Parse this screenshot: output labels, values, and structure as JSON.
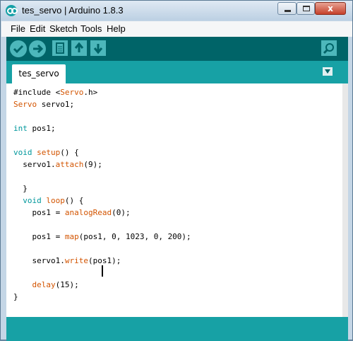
{
  "window": {
    "title": "tes_servo | Arduino 1.8.3",
    "controls": {
      "minimize": "minimize",
      "maximize": "maximize",
      "close": "x"
    }
  },
  "menu": [
    "File",
    "Edit",
    "Sketch",
    "Tools",
    "Help"
  ],
  "toolbar": {
    "verify_icon": "checkmark-icon",
    "upload_icon": "arrow-right-icon",
    "new_icon": "document-icon",
    "open_icon": "arrow-up-icon",
    "save_icon": "arrow-down-icon",
    "serial_monitor_icon": "magnifier-icon"
  },
  "tabs": [
    {
      "label": "tes_servo"
    }
  ],
  "editor": {
    "lines": [
      "#include <Servo.h>",
      "Servo servo1;",
      "",
      "int pos1;",
      "",
      "void setup() {",
      "  servo1.attach(9);",
      "",
      "  }",
      "  void loop() {",
      "    pos1 = analogRead(0);",
      "",
      "    pos1 = map(pos1, 0, 1023, 0, 200);",
      "",
      "    servo1.write(pos1);",
      "",
      "    delay(15);",
      "}"
    ]
  },
  "colors": {
    "toolbar": "#006468",
    "tab_bar": "#17a1a5",
    "button": "#4db7bb",
    "keyword_orange": "#d35400",
    "keyword_teal": "#00979c"
  }
}
